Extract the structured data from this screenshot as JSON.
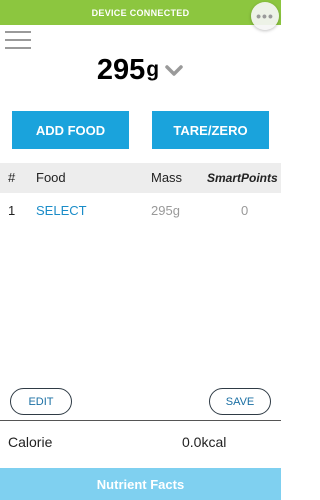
{
  "status_bar": {
    "text": "DEVICE CONNECTED",
    "color": "#8cc63f"
  },
  "overflow": {
    "icon": "more-dots-icon",
    "glyph": "•••"
  },
  "menu": {
    "icon": "hamburger-menu-icon"
  },
  "scale": {
    "weight": "295",
    "unit": "g",
    "dropdown_icon": "chevron-down-icon"
  },
  "actions": {
    "add_food": "ADD FOOD",
    "tare_zero": "TARE/ZERO",
    "color": "#1aa3dc"
  },
  "table": {
    "headers": {
      "number": "#",
      "food": "Food",
      "mass": "Mass",
      "smartpoints": "SmartPoints"
    },
    "rows": [
      {
        "number": "1",
        "food": "SELECT",
        "mass": "295g",
        "smartpoints": "0"
      }
    ]
  },
  "edit_button": "EDIT",
  "save_button": "SAVE",
  "calorie": {
    "label": "Calorie",
    "value": "0.0kcal"
  },
  "nutrient_facts": {
    "label": "Nutrient Facts",
    "color": "#7fd0f0"
  }
}
